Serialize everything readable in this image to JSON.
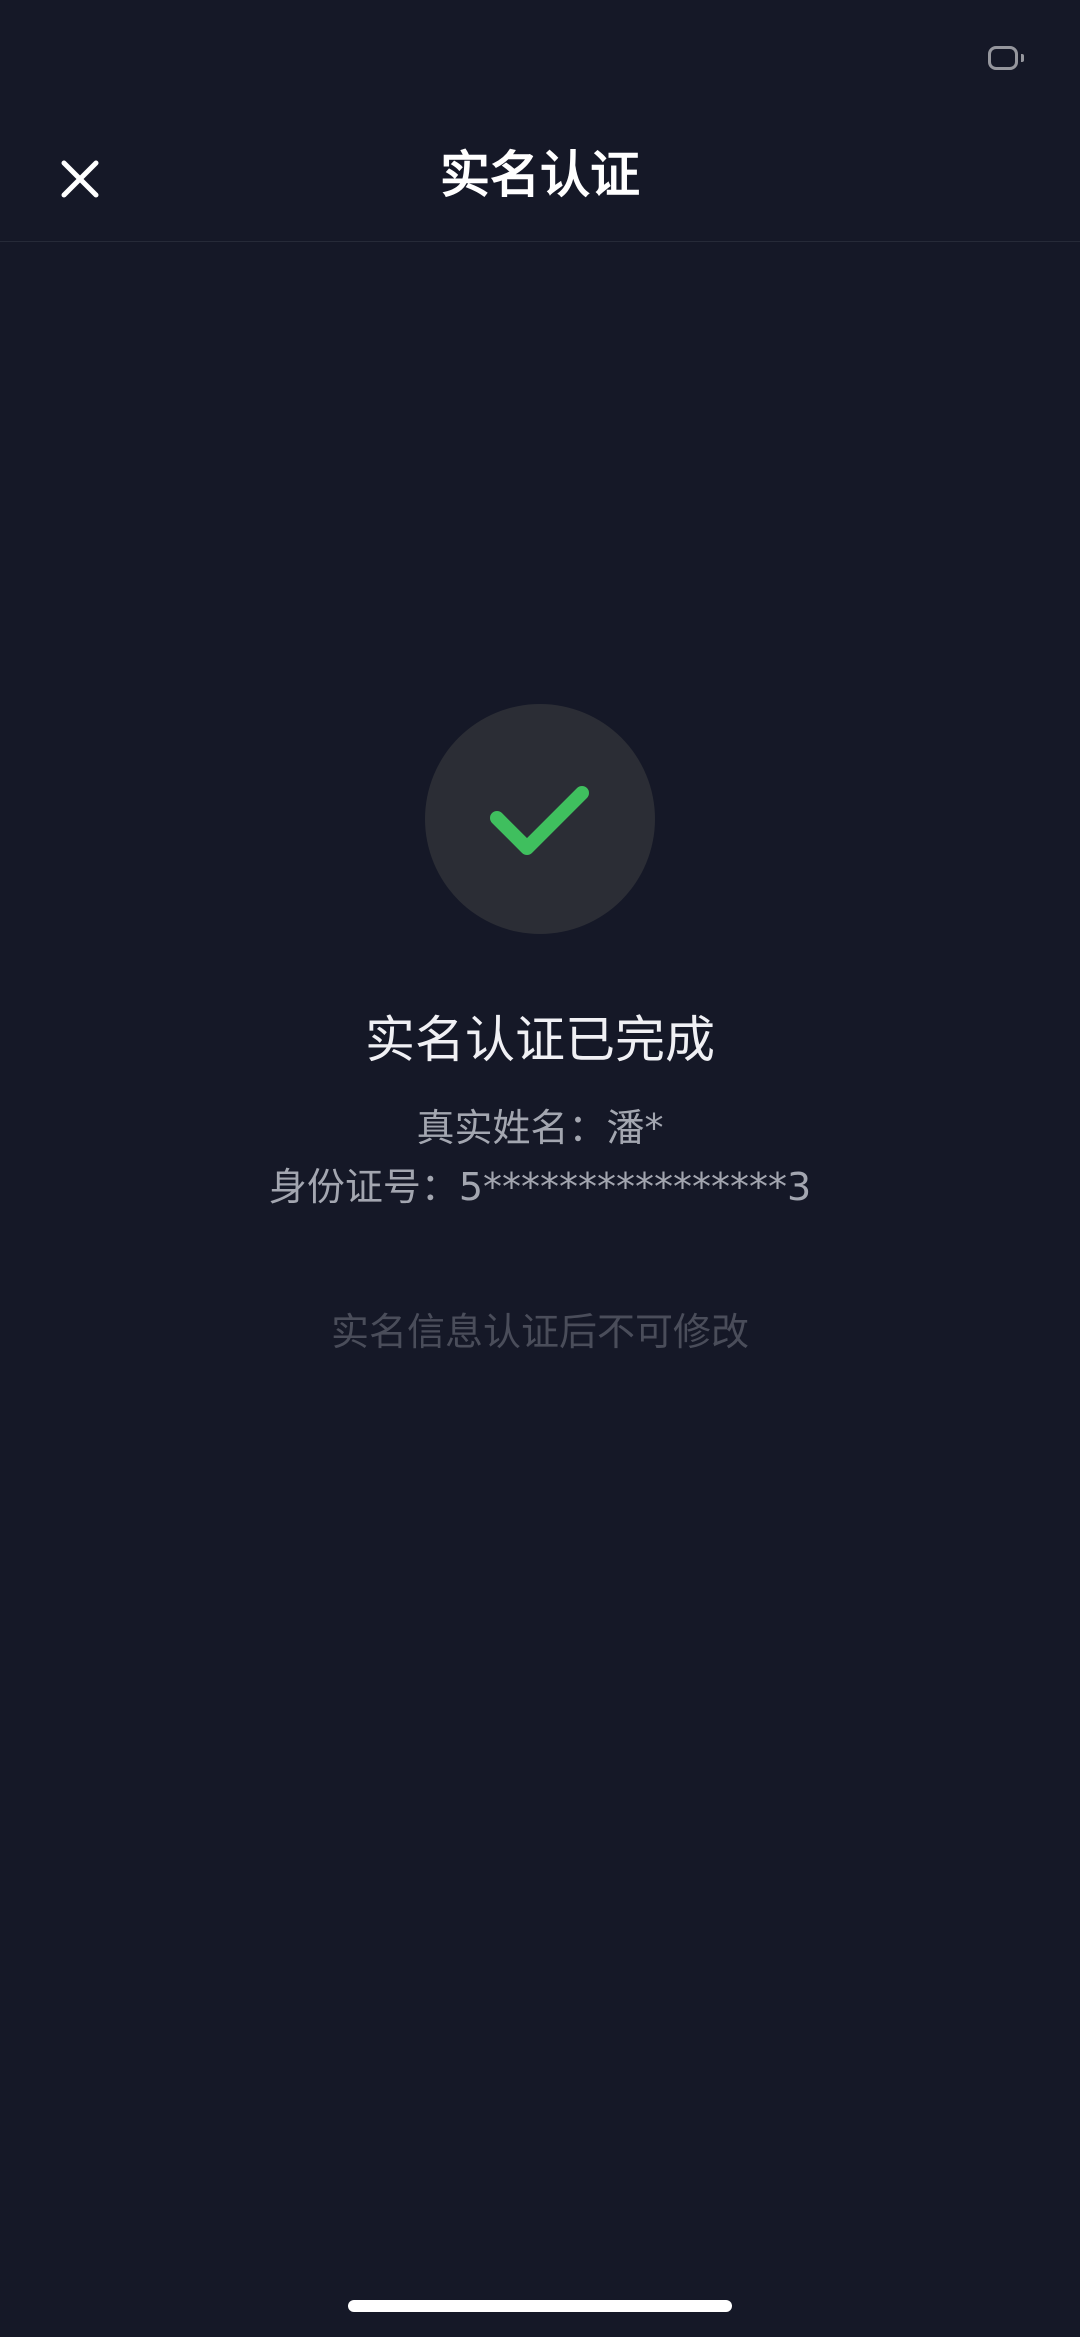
{
  "status_bar": {
    "battery_icon": "battery-icon"
  },
  "header": {
    "title": "实名认证",
    "close_icon": "close-icon"
  },
  "result": {
    "icon": "checkmark-icon",
    "icon_color": "#3fbf5e",
    "title": "实名认证已完成",
    "name_label": "真实姓名：",
    "name_value": "潘*",
    "id_label": "身份证号：",
    "id_value": "5****************3",
    "note": "实名信息认证后不可修改"
  },
  "colors": {
    "background": "#151827",
    "circle": "#2b2d35",
    "success": "#3fbf5e"
  }
}
